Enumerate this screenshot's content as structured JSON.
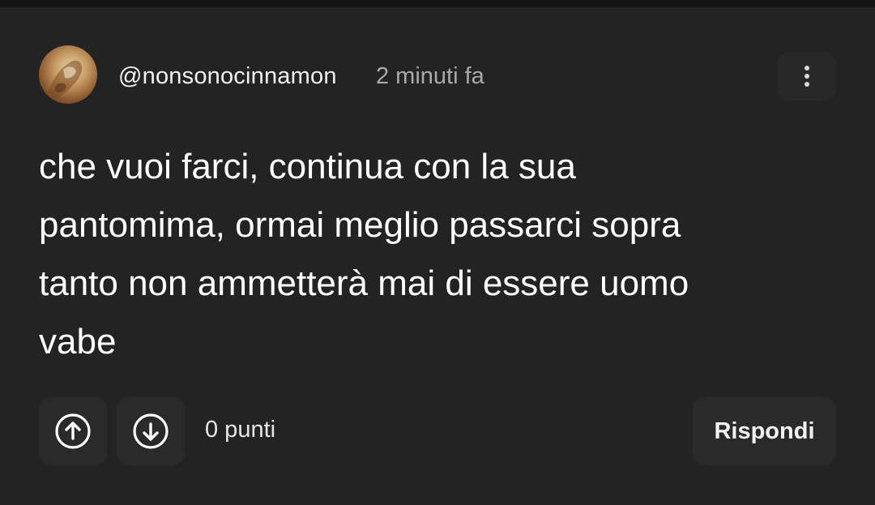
{
  "comment": {
    "username": "@nonsonocinnamon",
    "timestamp": "2 minuti fa",
    "body_lines": [
      "che vuoi farci, continua con la sua",
      "pantomima, ormai meglio passarci sopra",
      "tanto non ammetterà mai di essere uomo",
      "vabe"
    ]
  },
  "actions": {
    "upvote_icon": "arrow-up-circle-icon",
    "downvote_icon": "arrow-down-circle-icon",
    "more_icon": "vertical-dots-icon",
    "score": "0 punti",
    "reply_label": "Rispondi"
  },
  "colors": {
    "background": "#232323",
    "button_bg": "#2a2a2a",
    "text_primary": "#ffffff",
    "text_muted": "#a9a9a9"
  }
}
